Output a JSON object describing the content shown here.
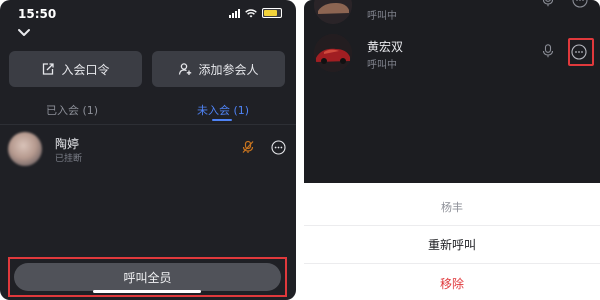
{
  "left": {
    "status_bar": {
      "time": "15:50"
    },
    "buttons": {
      "join_code": "入会口令",
      "add_participant": "添加参会人"
    },
    "tabs": {
      "joined": "已入会 (1)",
      "not_joined": "未入会 (1)"
    },
    "member": {
      "name": "陶婷",
      "status": "已挂断"
    },
    "call_all": "呼叫全员"
  },
  "right": {
    "top_row": {
      "status": "呼叫中"
    },
    "main_row": {
      "name": "黄宏双",
      "status": "呼叫中"
    },
    "sheet": {
      "title": "杨丰",
      "redial": "重新呼叫",
      "remove": "移除"
    }
  },
  "colors": {
    "accent_blue": "#4f83f5",
    "highlight_red": "#e0393c",
    "remove_red": "#e0393c",
    "dark_bg": "#1f2025"
  }
}
